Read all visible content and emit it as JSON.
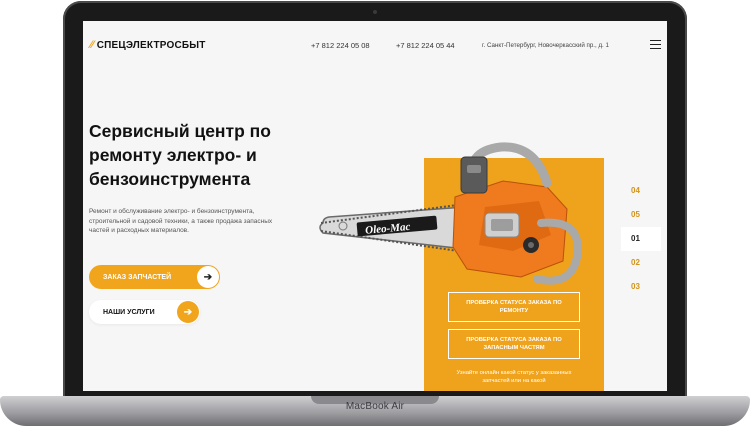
{
  "device": {
    "brand_label": "MacBook Air"
  },
  "header": {
    "logo_mark": "⁄⁄",
    "logo_text": "СПЕЦЭЛЕКТРОСБЫТ",
    "phone_1": "+7 812 224 05 08",
    "phone_2": "+7 812 224 05 44",
    "address": "г. Санкт-Петербург, Новочеркасский пр., д. 1"
  },
  "hero": {
    "title": "Сервисный центр по ремонту электро- и бензоинструмента",
    "description": "Ремонт и обслуживание электро- и бензоинструмента, строительной и садовой техники, а также продажа запасных частей и расходных материалов.",
    "primary_button": "ЗАКАЗ ЗАПЧАСТЕЙ",
    "secondary_button": "НАШИ УСЛУГИ",
    "arrow": "➔"
  },
  "product": {
    "brand_on_bar": "Oleo-Mac"
  },
  "panel": {
    "status_repair": "ПРОВЕРКА СТАТУСА ЗАКАЗА ПО РЕМОНТУ",
    "status_parts": "ПРОВЕРКА СТАТУСА ЗАКАЗА ПО ЗАПАСНЫМ ЧАСТЯМ",
    "note": "Узнайте онлайн какой статус у заказанных запчастей или на какой"
  },
  "pager": {
    "items": [
      "04",
      "05",
      "01",
      "02",
      "03"
    ],
    "active_index": 2
  },
  "colors": {
    "accent": "#f0a51d",
    "panel": "#efa21b",
    "text": "#111111",
    "background": "#f6f6f6"
  }
}
